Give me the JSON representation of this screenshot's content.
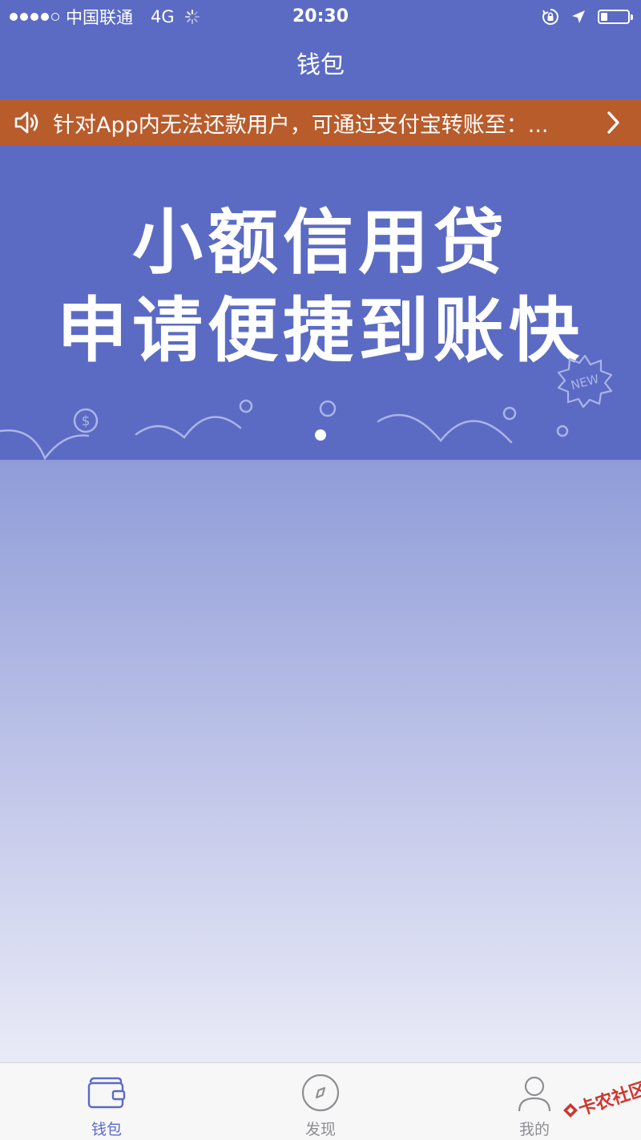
{
  "status_bar": {
    "carrier": "中国联通",
    "network": "4G",
    "time": "20:30",
    "battery_level": 0.25,
    "signal_bars_filled": 4,
    "signal_bars_total": 5
  },
  "nav": {
    "title": "钱包"
  },
  "notice": {
    "text": "针对App内无法还款用户，可通过支付宝转账至：..."
  },
  "banner": {
    "line1": "小额信用贷",
    "line2": "申请便捷到账快",
    "badge": "NEW",
    "coin_symbol": "$"
  },
  "tabs": [
    {
      "label": "钱包",
      "icon": "wallet-icon",
      "active": true
    },
    {
      "label": "发现",
      "icon": "compass-icon",
      "active": false
    },
    {
      "label": "我的",
      "icon": "user-icon",
      "active": false
    }
  ],
  "watermark": {
    "text": "卡农社区"
  },
  "colors": {
    "primary": "#5b6bc4",
    "notice_bg": "#b85c2c",
    "tab_active": "#5b6bc4",
    "tab_inactive": "#8e8e93"
  }
}
